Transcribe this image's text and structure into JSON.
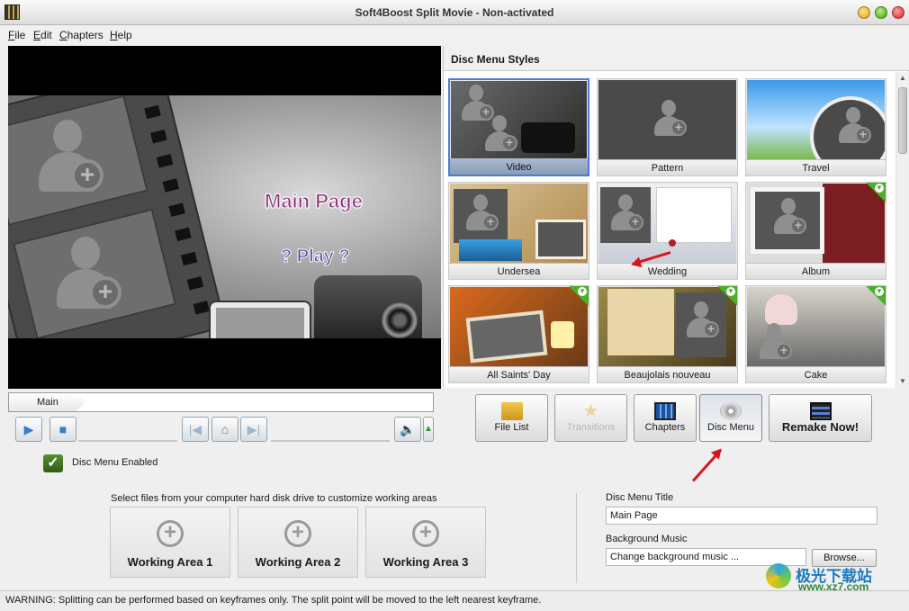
{
  "window": {
    "title": "Soft4Boost Split Movie - Non-activated"
  },
  "menu": {
    "items": [
      "File",
      "Edit",
      "Chapters",
      "Help"
    ]
  },
  "preview": {
    "title_text": "Main Page",
    "play_text": "? Play ?"
  },
  "timeline": {
    "tab_label": "Main"
  },
  "disc_menu_enabled": {
    "label": "Disc Menu Enabled",
    "checked": true
  },
  "styles": {
    "header": "Disc Menu Styles",
    "selected": "Video",
    "items": [
      {
        "label": "Video",
        "downloadable": false
      },
      {
        "label": "Pattern",
        "downloadable": false
      },
      {
        "label": "Travel",
        "downloadable": false
      },
      {
        "label": "Undersea",
        "downloadable": false
      },
      {
        "label": "Wedding",
        "downloadable": false
      },
      {
        "label": "Album",
        "downloadable": true
      },
      {
        "label": "All Saints' Day",
        "downloadable": true
      },
      {
        "label": "Beaujolais nouveau",
        "downloadable": true
      },
      {
        "label": "Cake",
        "downloadable": true
      }
    ]
  },
  "actions": {
    "file_list": "File List",
    "transitions": "Transitions",
    "chapters": "Chapters",
    "disc_menu": "Disc Menu",
    "remake_now": "Remake Now!"
  },
  "working_areas": {
    "caption": "Select files from your computer hard disk drive to customize working areas",
    "items": [
      "Working Area 1",
      "Working Area 2",
      "Working Area 3"
    ]
  },
  "settings": {
    "title_label": "Disc Menu Title",
    "title_value": "Main Page",
    "music_label": "Background Music",
    "music_value": "Change background music ...",
    "browse_label": "Browse..."
  },
  "status": {
    "message": "WARNING: Splitting can be performed based on keyframes only. The split point will be moved to the left nearest keyframe."
  },
  "watermark": {
    "text": "极光下载站",
    "url": "www.xz7.com"
  },
  "colors": {
    "selection_border": "#4c7bd1",
    "arrow": "#d9141b",
    "accent_green": "#4caf2a"
  }
}
